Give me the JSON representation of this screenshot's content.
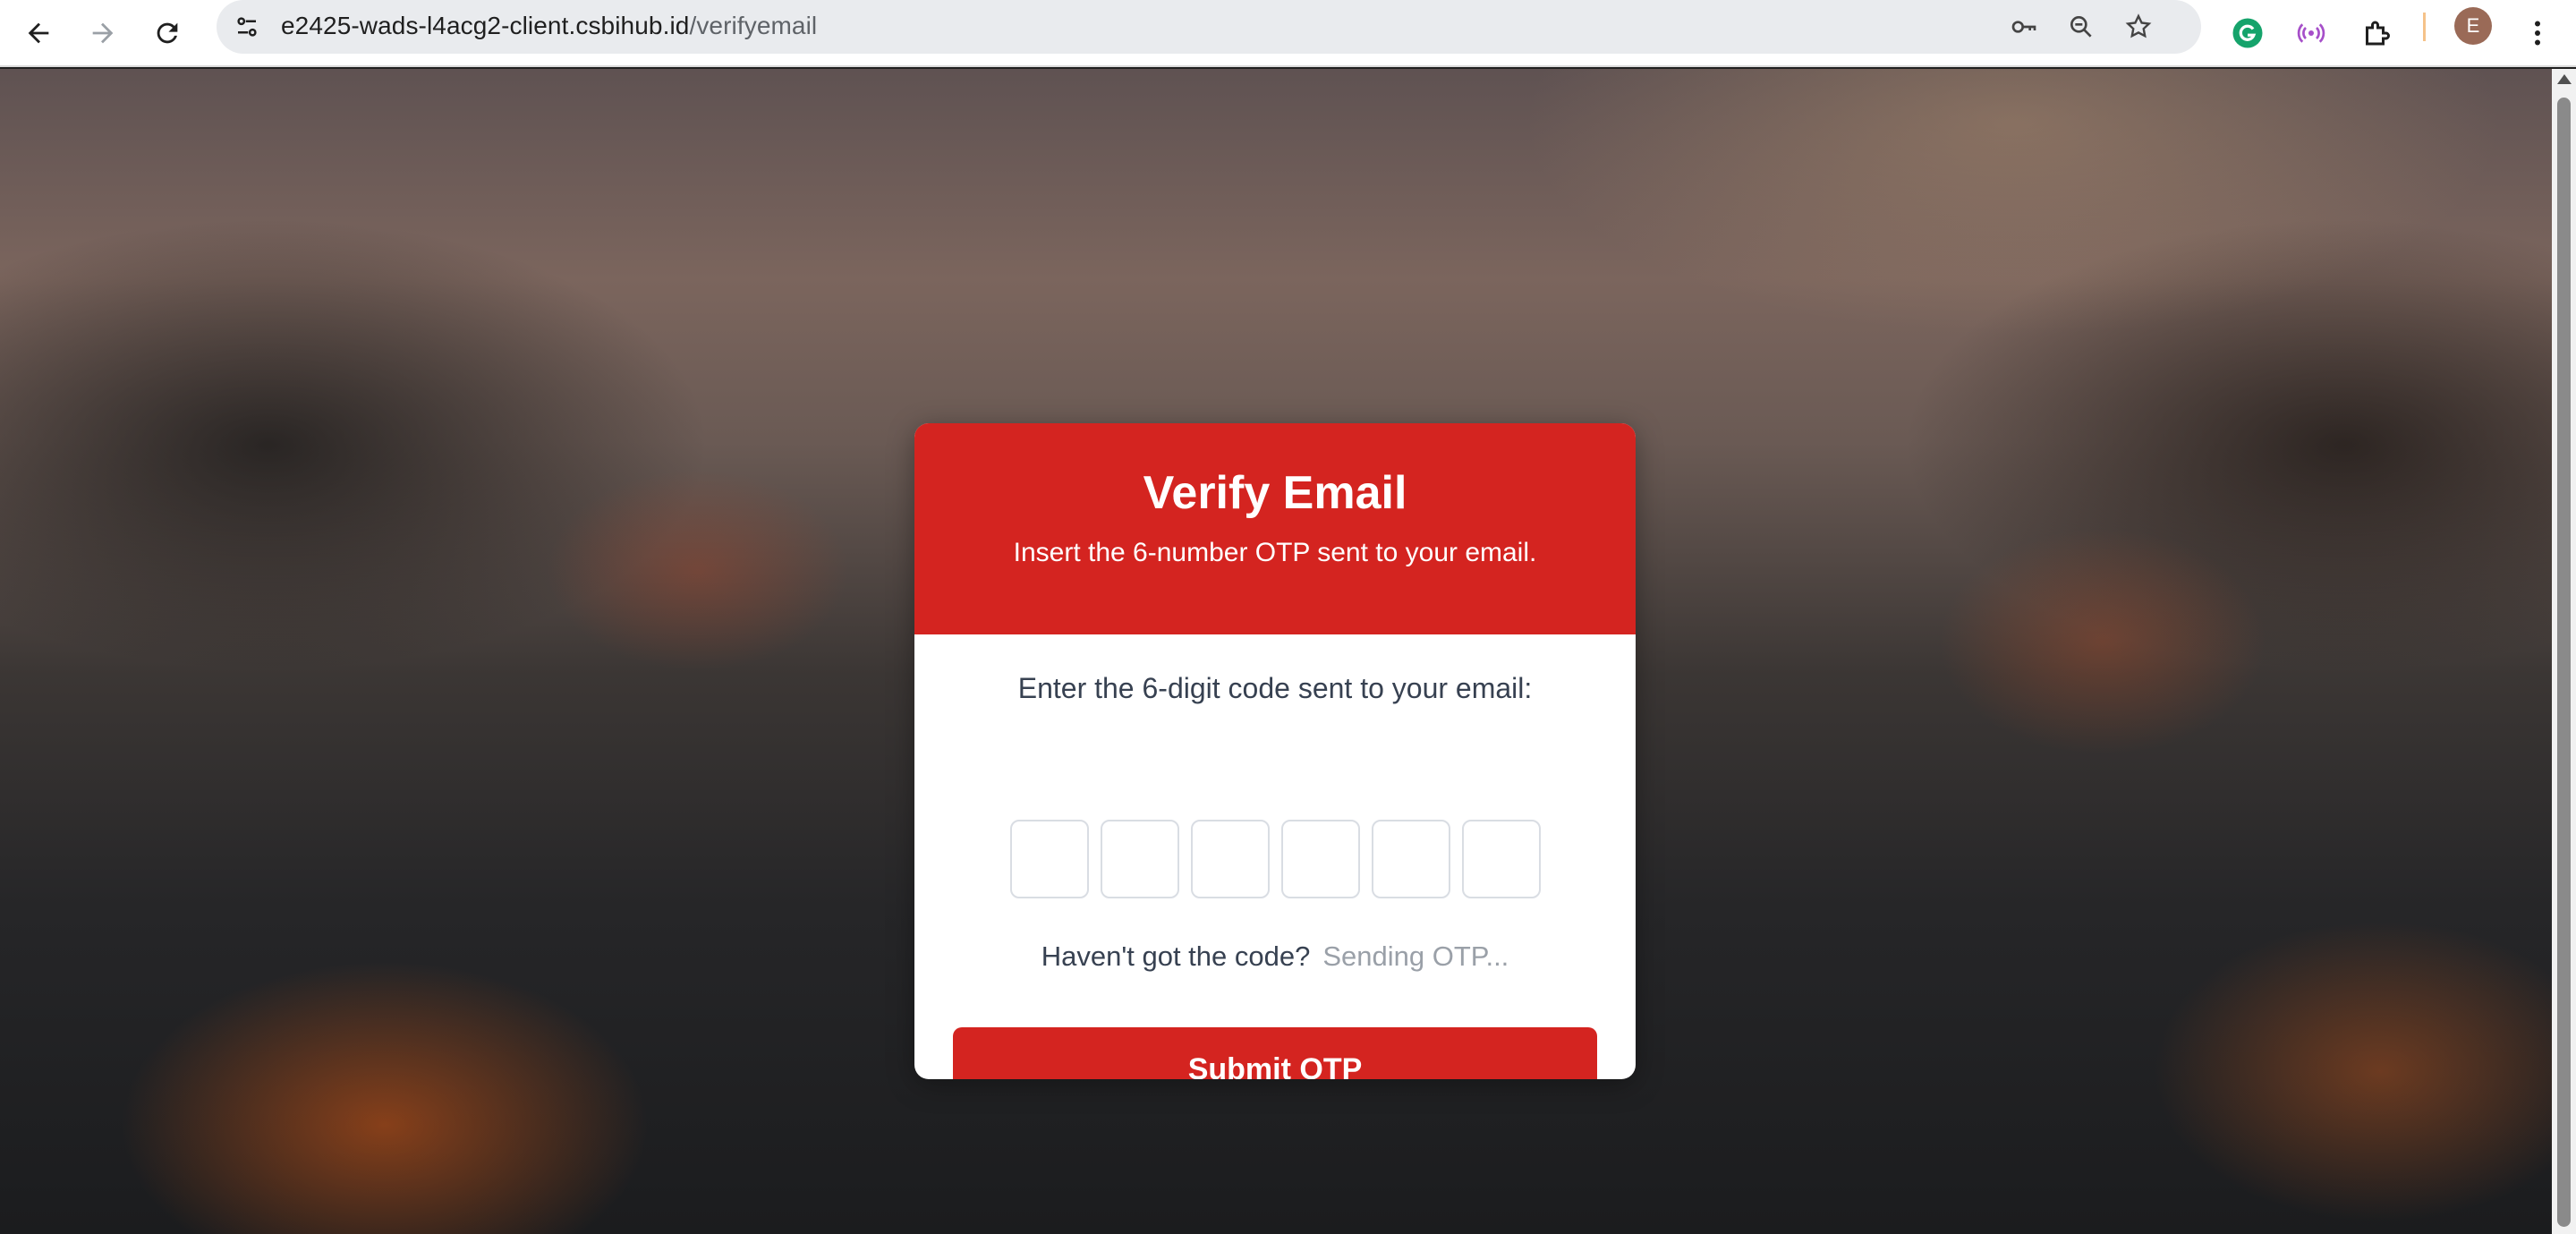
{
  "browser": {
    "url_host": "e2425-wads-l4acg2-client.csbihub.id",
    "url_path": "/verifyemail",
    "profile_initial": "E",
    "icons": [
      "back-icon",
      "forward-icon",
      "reload-icon",
      "site-info-icon",
      "password-key-icon",
      "zoom-icon",
      "bookmark-star-icon",
      "grammarly-icon",
      "broadcast-extension-icon",
      "extensions-puzzle-icon",
      "more-menu-icon"
    ]
  },
  "card": {
    "title": "Verify Email",
    "subtitle": "Insert the 6-number OTP sent to your email.",
    "prompt": "Enter the 6-digit code sent to your email:",
    "otp_digits": [
      "",
      "",
      "",
      "",
      "",
      ""
    ],
    "resend_question": "Haven't got the code?",
    "resend_status": "Sending OTP...",
    "submit_label": "Submit OTP"
  },
  "colors": {
    "accent_red": "#d42420",
    "text_dark": "#374151",
    "text_muted": "#9aa0a8"
  }
}
